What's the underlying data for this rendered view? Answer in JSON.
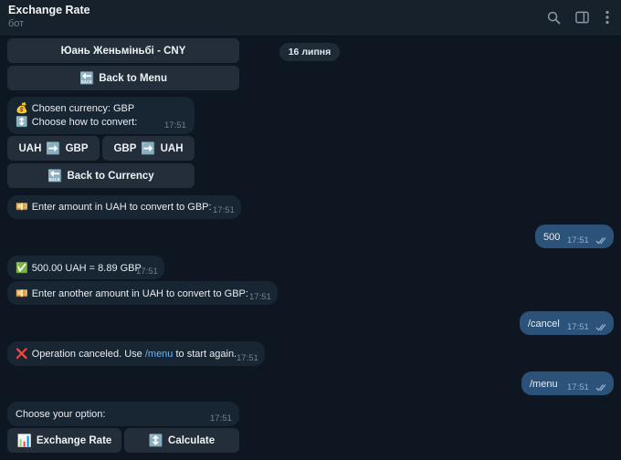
{
  "header": {
    "title": "Exchange Rate",
    "subtitle": "бот"
  },
  "date_label": "16 липня",
  "keyboard_top": {
    "cny_label": "Юань Женьміньбі - CNY",
    "back_menu_label": "Back to Menu"
  },
  "messages": [
    {
      "id": "m1",
      "line1": "Chosen currency: GBP",
      "line2": "Choose how to convert:",
      "time": "17:51"
    },
    {
      "id": "m2",
      "text": "Enter amount in UAH to convert to GBP:",
      "time": "17:51"
    },
    {
      "id": "m3",
      "text": "500",
      "time": "17:51"
    },
    {
      "id": "m4",
      "text": "500.00 UAH = 8.89 GBP",
      "time": "17:51"
    },
    {
      "id": "m5",
      "text": "Enter another amount in UAH to convert to GBP:",
      "time": "17:51"
    },
    {
      "id": "m6",
      "text": "/cancel",
      "time": "17:51"
    },
    {
      "id": "m7",
      "text_before": "Operation canceled. Use ",
      "link": "/menu",
      "text_after": " to start again.",
      "time": "17:51"
    },
    {
      "id": "m8",
      "text": "/menu",
      "time": "17:51"
    },
    {
      "id": "m9",
      "text": "Choose your option:",
      "time": "17:51"
    }
  ],
  "keyboard_convert": {
    "uah_to_gbp_from": "UAH",
    "uah_to_gbp_to": "GBP",
    "gbp_to_uah_from": "GBP",
    "gbp_to_uah_to": "UAH",
    "back_currency_label": "Back to Currency"
  },
  "keyboard_menu": {
    "exchange_rate_label": "Exchange Rate",
    "calculate_label": "Calculate"
  },
  "colors": {
    "background": "#0e1621",
    "header": "#17212b",
    "incoming_bubble": "#182533",
    "outgoing_bubble": "#2b5278",
    "keyboard_button": "#232e3a",
    "link": "#6ab3f3"
  },
  "icons": {
    "header": [
      "search-icon",
      "sidebar-toggle-icon",
      "more-vertical-icon"
    ],
    "back": "back-arrow-emoji",
    "moneybag": "money-bag-emoji",
    "arrows": "up-down-arrows-emoji",
    "right_arrow": "right-arrow-emoji",
    "banknote": "banknote-emoji",
    "check": "check-mark-emoji",
    "cross": "cross-mark-emoji",
    "chart": "bar-chart-emoji"
  }
}
